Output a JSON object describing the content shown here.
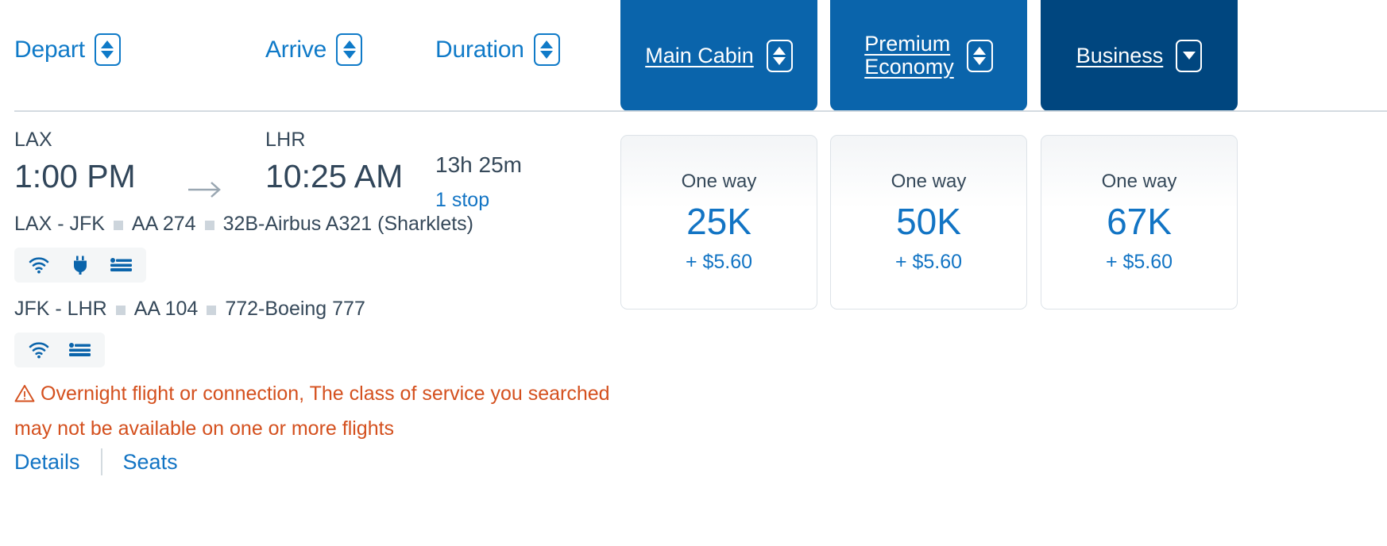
{
  "colors": {
    "link_blue": "#1274c4",
    "tab_blue": "#0a64ab",
    "tab_blue_selected": "#00467f",
    "warning_orange": "#d4501e",
    "text_dark": "#36495a"
  },
  "sort_headers": [
    {
      "label": "Depart",
      "icon": "sort-updown-icon",
      "state": "unsorted"
    },
    {
      "label": "Arrive",
      "icon": "sort-updown-icon",
      "state": "unsorted"
    },
    {
      "label": "Duration",
      "icon": "sort-updown-icon",
      "state": "unsorted"
    }
  ],
  "cabin_tabs": [
    {
      "label": "Main Cabin",
      "icon": "sort-updown-icon",
      "selected": false
    },
    {
      "label": "Premium\nEconomy",
      "icon": "sort-updown-icon",
      "selected": false
    },
    {
      "label": "Business",
      "icon": "sort-down-icon",
      "selected": true
    }
  ],
  "flight": {
    "depart": {
      "airport": "LAX",
      "time": "1:00 PM"
    },
    "arrive": {
      "airport": "LHR",
      "time": "10:25 AM"
    },
    "arrow_icon": "arrow-right-icon",
    "duration": "13h 25m",
    "stops": "1 stop",
    "segments": [
      {
        "route": "LAX - JFK",
        "flight_number": "AA 274",
        "aircraft": "32B-Airbus A321 (Sharklets)",
        "amenities": [
          "wifi-icon",
          "power-outlet-icon",
          "lie-flat-seat-icon"
        ]
      },
      {
        "route": "JFK - LHR",
        "flight_number": "AA 104",
        "aircraft": "772-Boeing 777",
        "amenities": [
          "wifi-icon",
          "lie-flat-seat-icon"
        ]
      }
    ],
    "warning": {
      "icon": "warning-triangle-icon",
      "text": "Overnight flight or connection, The class of service you searched may not be available on one or more flights"
    },
    "links": [
      {
        "label": "Details"
      },
      {
        "label": "Seats"
      }
    ]
  },
  "price_cards": [
    {
      "trip_type": "One way",
      "miles": "25K",
      "tax": "+ $5.60",
      "cabin": "Main Cabin"
    },
    {
      "trip_type": "One way",
      "miles": "50K",
      "tax": "+ $5.60",
      "cabin": "Premium Economy"
    },
    {
      "trip_type": "One way",
      "miles": "67K",
      "tax": "+ $5.60",
      "cabin": "Business"
    }
  ]
}
